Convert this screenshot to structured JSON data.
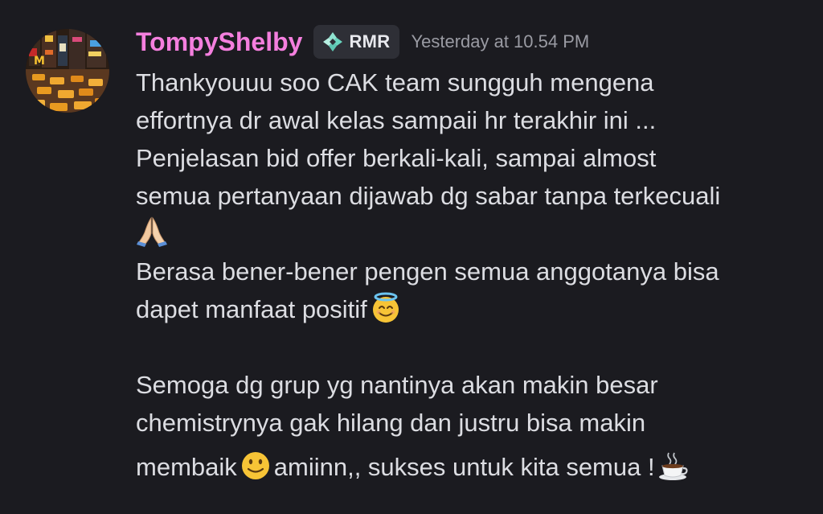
{
  "message": {
    "author": {
      "name": "TompyShelby",
      "name_color": "#f47fde",
      "avatar_icon": "city-street-avatar"
    },
    "role_tag": {
      "label": "RMR",
      "icon": "diamond-sparkle-icon"
    },
    "timestamp": "Yesterday at 10.54 PM",
    "lines": {
      "l1": "Thankyouuu soo CAK team sungguh mengena",
      "l2": "effortnya dr awal kelas sampaii hr terakhir ini ...",
      "l3": "Penjelasan bid offer berkali-kali, sampai almost",
      "l4": "semua pertanyaan dijawab dg sabar tanpa terkecuali",
      "l5": "Berasa bener-bener pengen semua anggotanya bisa",
      "l6": "dapet manfaat positif",
      "l7": "Semoga dg grup yg nantinya akan makin besar",
      "l8": "chemistrynya gak hilang dan justru bisa makin",
      "l9a": "membaik",
      "l9b": "amiinn,, sukses untuk kita semua !"
    },
    "emojis": {
      "pray": "folded-hands-emoji",
      "halo": "smiling-face-with-halo-emoji",
      "smile": "slightly-smiling-face-emoji",
      "coffee": "hot-beverage-emoji"
    }
  },
  "colors": {
    "background": "#1b1b20",
    "text": "#dcdde2",
    "timestamp": "#9a9ba3",
    "role_tag_bg": "#2e2f36"
  }
}
